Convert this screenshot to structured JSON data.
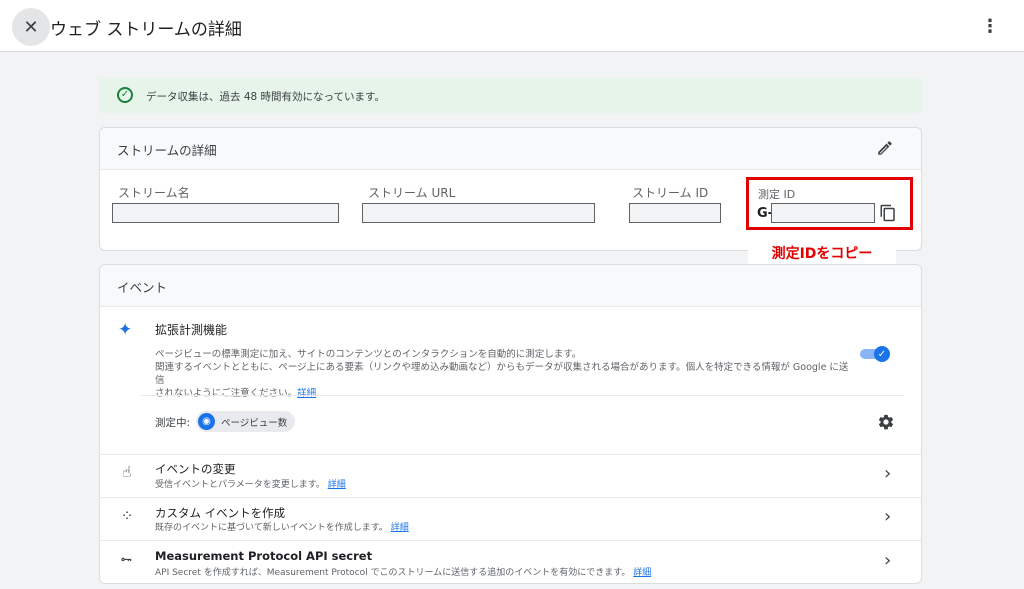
{
  "header": {
    "title": "ウェブ ストリームの詳細",
    "close_glyph": "✕",
    "more_glyph": "⋮"
  },
  "banner": {
    "text": "データ収集は、過去 48 時間有効になっています。",
    "icon": "check-circle-icon",
    "color": "#188038"
  },
  "stream_details": {
    "title": "ストリームの詳細",
    "edit_icon": "pencil-icon",
    "fields": [
      {
        "label": "ストリーム名",
        "value": ""
      },
      {
        "label": "ストリーム URL",
        "value": ""
      },
      {
        "label": "ストリーム ID",
        "value": ""
      }
    ],
    "measurement_id": {
      "label": "測定 ID",
      "prefix": "G-",
      "value": "",
      "copy_icon": "copy-icon"
    }
  },
  "annotation": {
    "callout": "測定IDをコピー",
    "color": "#e00000"
  },
  "events": {
    "title": "イベント",
    "enhanced": {
      "icon": "sparkle-icon",
      "title": "拡張計測機能",
      "desc_line1": "ページビューの標準測定に加え、サイトのコンテンツとのインタラクションを自動的に測定します。",
      "desc_line2": "関連するイベントとともに、ページ上にある要素（リンクや埋め込み動画など）からもデータが収集される場合があります。個人を特定できる情報が Google に送信",
      "desc_line3": "されないようにご注意ください。",
      "link": "詳細",
      "enabled": true
    },
    "measuring": {
      "label": "測定中:",
      "chip_label": "ページビュー数",
      "chip_icon": "eye-icon",
      "settings_icon": "gear-icon"
    },
    "rows": [
      {
        "icon": "touch-icon",
        "title": "イベントの変更",
        "desc": "受信イベントとパラメータを変更します。",
        "link": "詳細"
      },
      {
        "icon": "cursor-sparkle-icon",
        "title": "カスタム イベントを作成",
        "desc": "既存のイベントに基づいて新しいイベントを作成します。",
        "link": "詳細"
      },
      {
        "icon": "key-icon",
        "title": "Measurement Protocol API secret",
        "desc": "API Secret を作成すれば、Measurement Protocol でこのストリームに送信する追加のイベントを有効にできます。",
        "link": "詳細"
      }
    ]
  }
}
